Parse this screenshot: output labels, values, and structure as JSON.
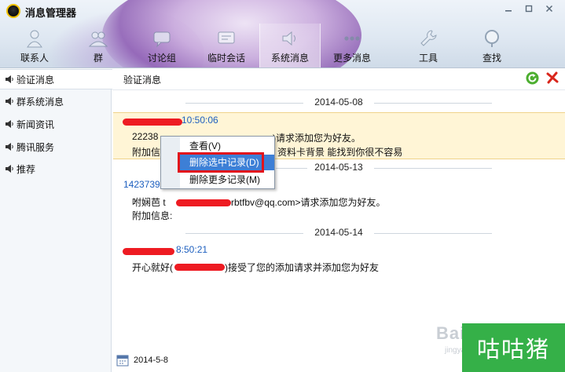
{
  "window": {
    "title": "消息管理器",
    "controls": [
      "minimize",
      "restore",
      "close"
    ]
  },
  "tabs": [
    {
      "label": "联系人",
      "icon": "person-icon"
    },
    {
      "label": "群",
      "icon": "group-icon"
    },
    {
      "label": "讨论组",
      "icon": "chat-icon"
    },
    {
      "label": "临时会话",
      "icon": "message-icon"
    },
    {
      "label": "系统消息",
      "icon": "speaker-icon",
      "active": true
    },
    {
      "label": "更多消息",
      "icon": "more-icon"
    },
    {
      "label": "工具",
      "icon": "wrench-icon"
    },
    {
      "label": "查找",
      "icon": "search-icon"
    }
  ],
  "sidebar": {
    "items": [
      {
        "label": "验证消息",
        "active": true
      },
      {
        "label": "群系统消息"
      },
      {
        "label": "新闻资讯"
      },
      {
        "label": "腾讯服务"
      },
      {
        "label": "推荐"
      }
    ]
  },
  "main": {
    "title": "验证消息",
    "dates": [
      "2014-05-08",
      "2014-05-13",
      "2014-05-14"
    ],
    "messages": [
      {
        "sender": "10:50:06",
        "line1": "22238",
        "line1_mid": ")请求添加您为好友。",
        "line2": "附加信",
        "line2_tail": "资料卡背景 能找到你很不容易"
      },
      {
        "sender": "1423739",
        "line1": "咐娴芭 t",
        "line1_tail": "rbtfbv@qq.com>请求添加您为好友。",
        "line2": "附加信息:"
      },
      {
        "sender": "8:50:21",
        "line1": "开心就好(",
        "line1_tail": ")接受了您的添加请求并添加您为好友"
      }
    ]
  },
  "context_menu": {
    "items": [
      "查看(V)",
      "删除选中记录(D)",
      "删除更多记录(M)"
    ],
    "hover_index": 1
  },
  "footer": {
    "date": "2014-5-8"
  },
  "watermark": {
    "baidu": "Bai",
    "jingyan": "jingyan",
    "badge": "咕咕猪"
  },
  "colors": {
    "accent": "#3d7fd6",
    "sender": "#1d5fbf",
    "selected_bg": "#fff5d6",
    "redaction": "#ee1b22",
    "badge": "#35b048"
  }
}
